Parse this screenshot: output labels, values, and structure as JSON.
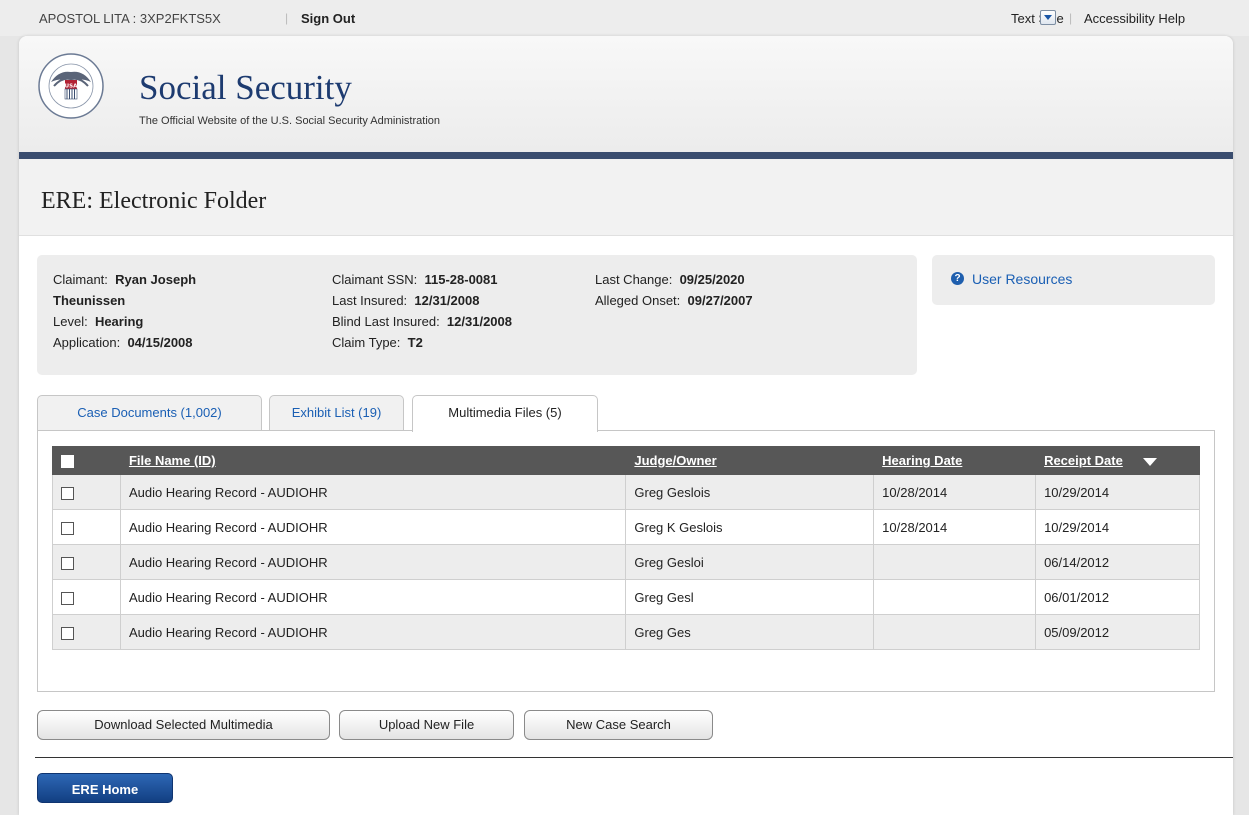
{
  "topbar": {
    "user": "APOSTOL LITA : 3XP2FKTS5X",
    "sign_out": "Sign Out",
    "text_size": "Text Size",
    "accessibility_help": "Accessibility Help"
  },
  "header": {
    "title": "Social Security",
    "subtitle": "The Official Website of the U.S. Social Security Administration",
    "seal_icon": "ssa-seal-icon"
  },
  "page": {
    "title": "ERE: Electronic Folder"
  },
  "claimant": {
    "claimant_label": "Claimant:",
    "claimant_name_1": "Ryan Joseph",
    "claimant_name_2": "Theunissen",
    "level_label": "Level:",
    "level_value": "Hearing",
    "application_label": "Application:",
    "application_value": "04/15/2008",
    "ssn_label": "Claimant SSN:",
    "ssn_value": "115-28-0081",
    "last_insured_label": "Last Insured:",
    "last_insured_value": "12/31/2008",
    "blind_last_insured_label": "Blind Last Insured:",
    "blind_last_insured_value": "12/31/2008",
    "claim_type_label": "Claim Type:",
    "claim_type_value": "T2",
    "last_change_label": "Last Change:",
    "last_change_value": "09/25/2020",
    "alleged_onset_label": "Alleged Onset:",
    "alleged_onset_value": "09/27/2007"
  },
  "resources": {
    "link": "User Resources"
  },
  "tabs": [
    {
      "label": "Case Documents (1,002)"
    },
    {
      "label": "Exhibit List (19)"
    },
    {
      "label": "Multimedia Files (5)"
    }
  ],
  "table": {
    "columns": [
      "File Name (ID)",
      "Judge/Owner",
      "Hearing Date",
      "Receipt Date"
    ],
    "rows": [
      {
        "file": "Audio Hearing Record - AUDIOHR",
        "judge": "Greg Geslois",
        "hearing": "10/28/2014",
        "receipt": "10/29/2014"
      },
      {
        "file": "Audio Hearing Record - AUDIOHR",
        "judge": "Greg K Geslois",
        "hearing": "10/28/2014",
        "receipt": "10/29/2014"
      },
      {
        "file": "Audio Hearing Record - AUDIOHR",
        "judge": "Greg Gesloi",
        "hearing": "",
        "receipt": "06/14/2012"
      },
      {
        "file": "Audio Hearing Record - AUDIOHR",
        "judge": "Greg Gesl",
        "hearing": "",
        "receipt": "06/01/2012"
      },
      {
        "file": "Audio Hearing Record - AUDIOHR",
        "judge": "Greg Ges",
        "hearing": "",
        "receipt": "05/09/2012"
      }
    ]
  },
  "buttons": {
    "download": "Download Selected Multimedia",
    "upload": "Upload New File",
    "new_search": "New Case Search",
    "ere_home": "ERE Home"
  },
  "colors": {
    "brand_navy": "#1d3b70",
    "header_rule": "#3a4d6f",
    "link_blue": "#1a5fb4",
    "table_header": "#575757"
  }
}
